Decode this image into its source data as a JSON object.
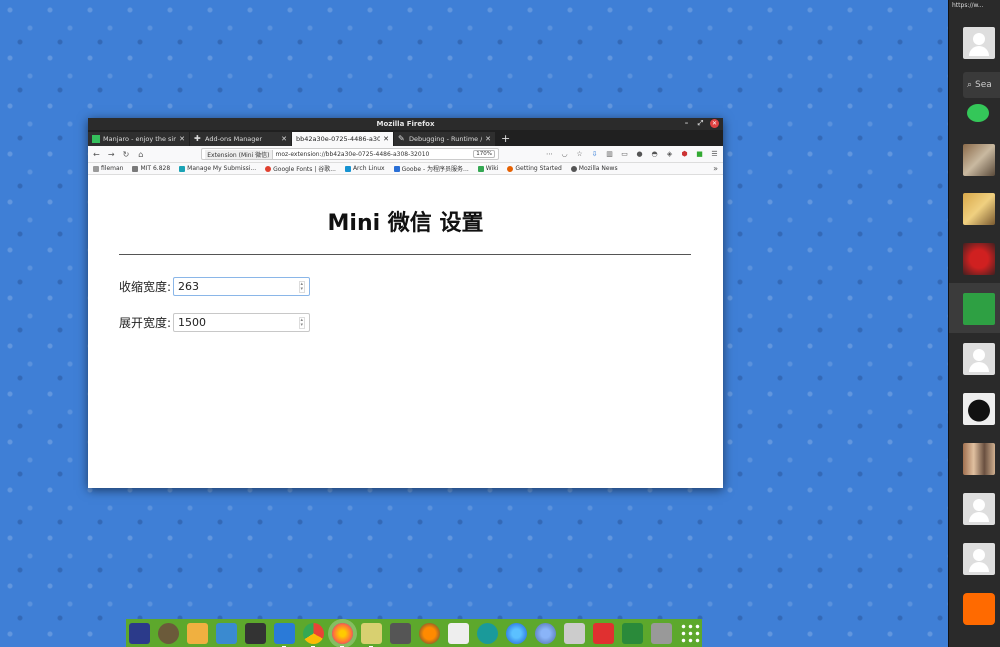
{
  "window": {
    "title": "Mozilla Firefox",
    "controls": [
      "minimize",
      "maximize",
      "close"
    ]
  },
  "tabs": [
    {
      "label": "Manjaro - enjoy the sim",
      "icon": "manjaro-icon",
      "active": false
    },
    {
      "label": "Add-ons Manager",
      "icon": "puzzle-icon",
      "active": false
    },
    {
      "label": "bb42a30e-0725-4486-a308",
      "icon": "",
      "active": true
    },
    {
      "label": "Debugging - Runtime /",
      "icon": "wrench-icon",
      "active": false
    }
  ],
  "nav": {
    "back": "←",
    "forward": "→",
    "reload": "↻",
    "home": "⌂"
  },
  "urlbar": {
    "identity": "Extension (Mini 微信)",
    "url": "moz-extension://bb42a30e-0725-4486-a308-32010",
    "zoom": "170%"
  },
  "toolbar_icons": [
    "more-icon",
    "pocket-icon",
    "bookmark-star-icon",
    "download-icon",
    "library-icon",
    "sidebar-icon",
    "extension-icon",
    "mask-icon",
    "shield-icon",
    "adblock-icon",
    "green-extension-icon",
    "menu-icon"
  ],
  "bookmarks": [
    {
      "label": "fileman",
      "color": "#9a9a9a"
    },
    {
      "label": "MIT 6.828",
      "color": "#7a7a7a"
    },
    {
      "label": "Manage My Submissi...",
      "color": "#1aa3b5"
    },
    {
      "label": "Google Fonts | 谷歌...",
      "color": "#e0402f"
    },
    {
      "label": "Arch Linux",
      "color": "#1793d1"
    },
    {
      "label": "Goobe - 为程序员服务...",
      "color": "#2a6fd6"
    },
    {
      "label": "Wiki",
      "color": "#35a853"
    },
    {
      "label": "Getting Started",
      "color": "#e66000"
    },
    {
      "label": "Mozilla News",
      "color": "#555555"
    }
  ],
  "page": {
    "title": "Mini 微信 设置",
    "collapse_label": "收缩宽度:",
    "collapse_value": "263",
    "expand_label": "展开宽度:",
    "expand_value": "1500"
  },
  "right_dock": {
    "url": "https://w...",
    "search_label": "Sea"
  },
  "bottom_dock": {
    "apps": [
      "ubuntu-icon",
      "gimp-icon",
      "downloader-icon",
      "system-monitor-icon",
      "terminal-icon",
      "text-editor-icon",
      "chrome-icon",
      "firefox-icon",
      "archive-icon",
      "calculator-icon",
      "clementine-icon",
      "document-icon",
      "aperture-icon",
      "firefox-dev-icon",
      "chromium-icon",
      "film-icon",
      "dc-icon",
      "lock-icon",
      "trash-icon",
      "app-grid-icon"
    ]
  }
}
